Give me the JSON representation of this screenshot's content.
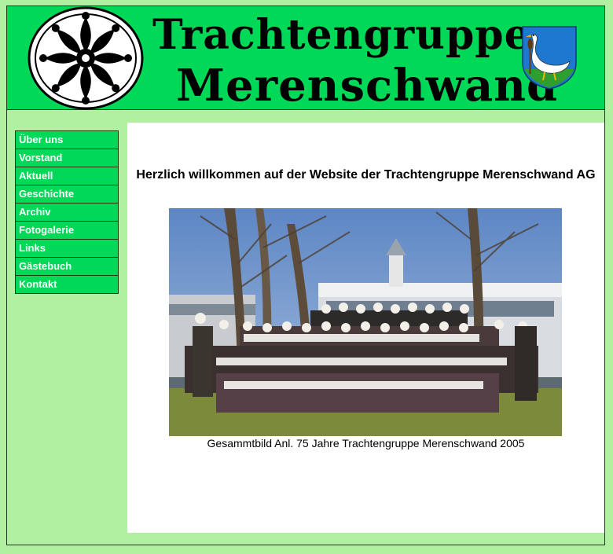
{
  "header": {
    "title_line1": "Trachtengruppe",
    "title_line2": "Merenschwand"
  },
  "nav": {
    "items": [
      {
        "label": "Über uns"
      },
      {
        "label": "Vorstand"
      },
      {
        "label": "Aktuell"
      },
      {
        "label": "Geschichte"
      },
      {
        "label": "Archiv"
      },
      {
        "label": "Fotogalerie"
      },
      {
        "label": "Links"
      },
      {
        "label": "Gästebuch"
      },
      {
        "label": "Kontakt"
      }
    ]
  },
  "main": {
    "welcome": "Herzlich willkommen auf der Website der Trachtengruppe Merenschwand AG",
    "caption": "Gesammtbild Anl. 75 Jahre Trachtengruppe Merenschwand 2005"
  },
  "colors": {
    "header_green": "#00d957",
    "page_bg": "#b0f0a0",
    "nav_green": "#00d957",
    "crest_blue": "#1e78d0"
  }
}
